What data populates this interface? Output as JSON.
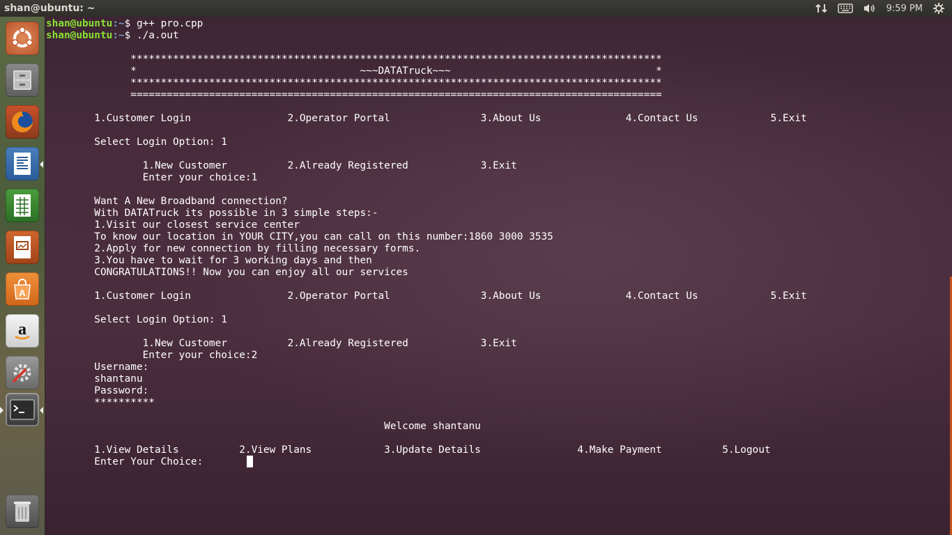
{
  "window": {
    "title": "shan@ubuntu: ~"
  },
  "panel": {
    "clock": "9:59 PM"
  },
  "launcher": {
    "items": [
      {
        "name": "Dash home"
      },
      {
        "name": "Files"
      },
      {
        "name": "Firefox Web Browser"
      },
      {
        "name": "LibreOffice Writer"
      },
      {
        "name": "LibreOffice Calc"
      },
      {
        "name": "LibreOffice Impress"
      },
      {
        "name": "Ubuntu Software Center"
      },
      {
        "name": "Amazon"
      },
      {
        "name": "System Settings"
      },
      {
        "name": "Terminal"
      },
      {
        "name": "Trash"
      }
    ]
  },
  "terminal": {
    "prompt_user": "shan@ubuntu",
    "prompt_path": ":~",
    "prompt_symbol": "$ ",
    "commands": [
      "g++ pro.cpp",
      "./a.out"
    ],
    "output_lines": [
      "              ****************************************************************************************",
      "              *                                     ~~~DATATruck~~~                                  *",
      "              ****************************************************************************************",
      "              ========================================================================================",
      "",
      "        1.Customer Login                2.Operator Portal               3.About Us              4.Contact Us            5.Exit",
      "",
      "        Select Login Option: 1",
      "",
      "                1.New Customer          2.Already Registered            3.Exit",
      "                Enter your choice:1",
      "",
      "        Want A New Broadband connection?",
      "        With DATATruck its possible in 3 simple steps:-",
      "        1.Visit our closest service center",
      "        To know our location in YOUR CITY,you can call on this number:1860 3000 3535",
      "        2.Apply for new connection by filling necessary forms.",
      "        3.You have to wait for 3 working days and then",
      "        CONGRATULATIONS!! Now you can enjoy all our services",
      "",
      "        1.Customer Login                2.Operator Portal               3.About Us              4.Contact Us            5.Exit",
      "",
      "        Select Login Option: 1",
      "",
      "                1.New Customer          2.Already Registered            3.Exit",
      "                Enter your choice:2",
      "        Username:",
      "        shantanu",
      "        Password:",
      "        **********",
      "",
      "                                                        Welcome shantanu",
      "",
      "        1.View Details          2.View Plans            3.Update Details                4.Make Payment          5.Logout",
      "        Enter Your Choice:      "
    ]
  }
}
